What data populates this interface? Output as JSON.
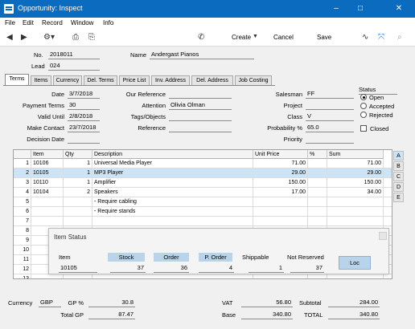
{
  "window": {
    "title": "Opportunity: Inspect",
    "minimize": "–",
    "maximize": "□",
    "close": "✕"
  },
  "menu": [
    "File",
    "Edit",
    "Record",
    "Window",
    "Info"
  ],
  "toolbar": {
    "create": "Create",
    "cancel": "Cancel",
    "save": "Save"
  },
  "header": {
    "no_label": "No.",
    "no_value": "2018011",
    "name_label": "Name",
    "name_value": "Andergast Pianos",
    "lead_label": "Lead",
    "lead_value": "024"
  },
  "tabs": [
    "Terms",
    "Items",
    "Currency",
    "Del. Terms",
    "Price List",
    "Inv. Address",
    "Del. Address",
    "Job Costing"
  ],
  "terms": {
    "date_label": "Date",
    "date_value": "3/7/2018",
    "payment_terms_label": "Payment Terms",
    "payment_terms_value": "30",
    "valid_until_label": "Valid Until",
    "valid_until_value": "2/8/2018",
    "make_contact_label": "Make Contact",
    "make_contact_value": "23/7/2018",
    "decision_date_label": "Decision Date",
    "decision_date_value": "",
    "our_reference_label": "Our Reference",
    "our_reference_value": "",
    "attention_label": "Attention",
    "attention_value": "Olivia Olman",
    "tags_label": "Tags/Objects",
    "tags_value": "",
    "reference_label": "Reference",
    "reference_value": "",
    "salesman_label": "Salesman",
    "salesman_value": "FF",
    "project_label": "Project",
    "project_value": "",
    "class_label": "Class",
    "class_value": "V",
    "probability_label": "Probability %",
    "probability_value": "65.0",
    "priority_label": "Priority",
    "priority_value": ""
  },
  "status": {
    "label": "Status",
    "options": [
      "Open",
      "Accepted",
      "Rejected"
    ],
    "selected": "Open",
    "closed_label": "Closed"
  },
  "grid": {
    "headers": [
      "Item",
      "Qty",
      "Description",
      "Unit Price",
      "%",
      "Sum"
    ],
    "rows": [
      {
        "num": "1",
        "item": "10106",
        "qty": "1",
        "desc": "Universal Media Player",
        "price": "71.00",
        "pct": "",
        "sum": "71.00"
      },
      {
        "num": "2",
        "item": "10105",
        "qty": "1",
        "desc": "MP3 Player",
        "price": "29.00",
        "pct": "",
        "sum": "29.00"
      },
      {
        "num": "3",
        "item": "10110",
        "qty": "1",
        "desc": "Amplifier",
        "price": "150.00",
        "pct": "",
        "sum": "150.00"
      },
      {
        "num": "4",
        "item": "10104",
        "qty": "2",
        "desc": "Speakers",
        "price": "17.00",
        "pct": "",
        "sum": "34.00"
      },
      {
        "num": "5",
        "item": "",
        "qty": "",
        "desc": "- Require cabling",
        "price": "",
        "pct": "",
        "sum": ""
      },
      {
        "num": "6",
        "item": "",
        "qty": "",
        "desc": "- Require stands",
        "price": "",
        "pct": "",
        "sum": ""
      },
      {
        "num": "7",
        "item": "",
        "qty": "",
        "desc": "",
        "price": "",
        "pct": "",
        "sum": ""
      },
      {
        "num": "8",
        "item": "",
        "qty": "",
        "desc": "",
        "price": "",
        "pct": "",
        "sum": ""
      },
      {
        "num": "9",
        "item": "",
        "qty": "",
        "desc": "",
        "price": "",
        "pct": "",
        "sum": ""
      },
      {
        "num": "10",
        "item": "",
        "qty": "",
        "desc": "",
        "price": "",
        "pct": "",
        "sum": ""
      },
      {
        "num": "11",
        "item": "",
        "qty": "",
        "desc": "",
        "price": "",
        "pct": "",
        "sum": ""
      },
      {
        "num": "12",
        "item": "",
        "qty": "",
        "desc": "",
        "price": "",
        "pct": "",
        "sum": ""
      },
      {
        "num": "13",
        "item": "",
        "qty": "",
        "desc": "",
        "price": "",
        "pct": "",
        "sum": ""
      }
    ],
    "side_tabs": [
      "A",
      "B",
      "C",
      "D",
      "E"
    ]
  },
  "item_status": {
    "title": "Item Status",
    "item_label": "Item",
    "item_value": "10105",
    "stock_label": "Stock",
    "stock_value": "37",
    "order_label": "Order",
    "order_value": "36",
    "porder_label": "P. Order",
    "porder_value": "4",
    "shippable_label": "Shippable",
    "shippable_value": "1",
    "not_reserved_label": "Not Reserved",
    "not_reserved_value": "37",
    "loc_label": "Loc"
  },
  "footer": {
    "currency_label": "Currency",
    "currency_value": "GBP",
    "gp_pct_label": "GP %",
    "gp_pct_value": "30.8",
    "total_gp_label": "Total GP",
    "total_gp_value": "87.47",
    "vat_label": "VAT",
    "vat_value": "56.80",
    "base_label": "Base",
    "base_value": "340.80",
    "subtotal_label": "Subtotal",
    "subtotal_value": "284.00",
    "total_label": "TOTAL",
    "total_value": "340.80"
  },
  "colors": {
    "titlebar": "#0b6bbf",
    "selected_row": "#cde4f7",
    "button_blue": "#b9d4ea"
  }
}
